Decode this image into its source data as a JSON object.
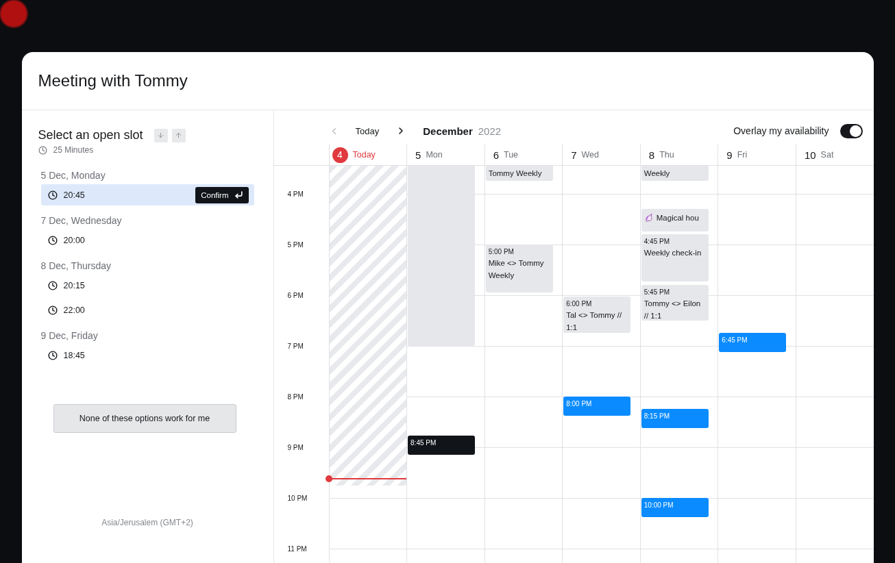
{
  "window": {
    "title": "Meeting with Tommy"
  },
  "slot_picker": {
    "title": "Select an open slot",
    "duration": "25 Minutes",
    "confirm_label": "Confirm",
    "groups": [
      {
        "date": "5 Dec, Monday",
        "slots": [
          {
            "time": "20:45",
            "selected": true
          }
        ]
      },
      {
        "date": "7 Dec, Wednesday",
        "slots": [
          {
            "time": "20:00",
            "selected": false
          }
        ]
      },
      {
        "date": "8 Dec, Thursday",
        "slots": [
          {
            "time": "20:15",
            "selected": false
          },
          {
            "time": "22:00",
            "selected": false
          }
        ]
      },
      {
        "date": "9 Dec, Friday",
        "slots": [
          {
            "time": "18:45",
            "selected": false
          }
        ]
      }
    ],
    "decline_button": "None of these options work for me",
    "timezone": "Asia/Jerusalem (GMT+2)"
  },
  "calendar": {
    "prev_disabled": true,
    "today_button": "Today",
    "month": "December",
    "year": "2022",
    "overlay": {
      "label": "Overlay my availability",
      "on": true
    },
    "hours": [
      "4 PM",
      "5 PM",
      "6 PM",
      "7 PM",
      "8 PM",
      "9 PM",
      "10 PM",
      "11 PM"
    ],
    "days": [
      {
        "number": "4",
        "weekday": "Today",
        "today": true
      },
      {
        "number": "5",
        "weekday": "Mon",
        "today": false,
        "events": [
          {
            "kind": "busy"
          },
          {
            "kind": "chosen",
            "time": "8:45 PM"
          }
        ]
      },
      {
        "number": "6",
        "weekday": "Tue",
        "today": false,
        "events": [
          {
            "kind": "busy",
            "title": "Tommy Weekly"
          },
          {
            "kind": "busy",
            "time": "5:00 PM",
            "title": "Mike <> Tommy Weekly"
          }
        ]
      },
      {
        "number": "7",
        "weekday": "Wed",
        "today": false,
        "events": [
          {
            "kind": "busy",
            "time": "6:00 PM",
            "title": "Tal <> Tommy // 1:1"
          },
          {
            "kind": "open",
            "time": "8:00 PM"
          }
        ]
      },
      {
        "number": "8",
        "weekday": "Thu",
        "today": false,
        "events": [
          {
            "kind": "busy",
            "title": "Weekly"
          },
          {
            "kind": "busy",
            "title": "Magical hou",
            "icon": true
          },
          {
            "kind": "busy",
            "time": "4:45 PM",
            "title": "Weekly check-in"
          },
          {
            "kind": "busy",
            "time": "5:45 PM",
            "title": "Tommy <> Eilon // 1:1"
          },
          {
            "kind": "open",
            "time": "8:15 PM"
          },
          {
            "kind": "open",
            "time": "10:00 PM"
          }
        ]
      },
      {
        "number": "9",
        "weekday": "Fri",
        "today": false,
        "events": [
          {
            "kind": "open",
            "time": "6:45 PM"
          }
        ]
      },
      {
        "number": "10",
        "weekday": "Sat",
        "today": false
      }
    ]
  }
}
